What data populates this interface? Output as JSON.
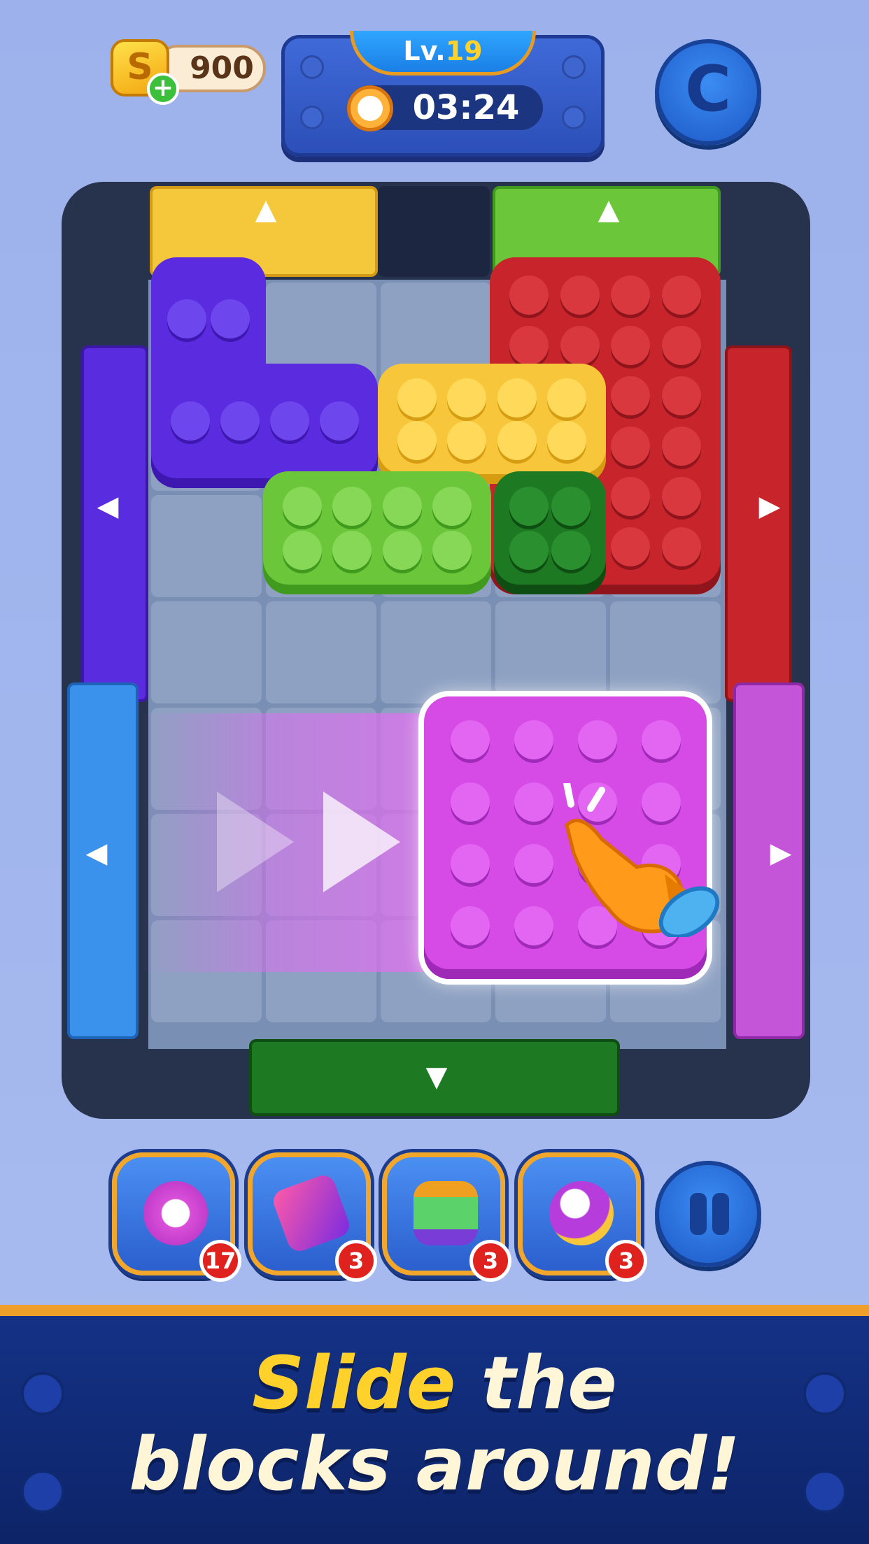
{
  "header": {
    "coins": "900",
    "coin_icon_glyph": "S",
    "add_coins_glyph": "+",
    "level_prefix": "Lv.",
    "level_number": "19",
    "timer": "03:24",
    "restart_glyph": "C"
  },
  "board": {
    "wall_arrow_up": "▲",
    "wall_arrow_down": "▼",
    "wall_arrow_left": "◀",
    "wall_arrow_right": "▶",
    "colors": {
      "purple": "#5b2be0",
      "yellow": "#f7c63a",
      "red": "#c8242c",
      "green": "#6cc63a",
      "dark_green": "#1e7a22",
      "magenta": "#d64ae6",
      "blue": "#3a92ec"
    }
  },
  "boosters": [
    {
      "name": "alarm-clock",
      "count": "17"
    },
    {
      "name": "hammer",
      "count": "3"
    },
    {
      "name": "vacuum",
      "count": "3"
    },
    {
      "name": "rocket",
      "count": "3"
    }
  ],
  "banner": {
    "headline_highlight": "Slide",
    "headline_line1_rest": " the",
    "headline_line2": "blocks around!"
  }
}
